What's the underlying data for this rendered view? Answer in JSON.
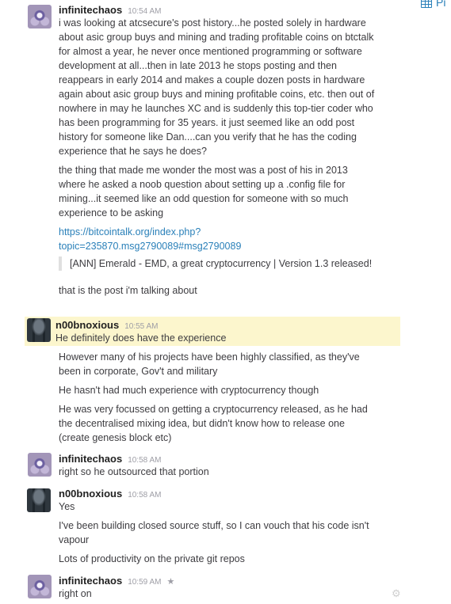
{
  "topright": {
    "label": "Pi"
  },
  "messages": [
    {
      "user": "infinitechaos",
      "time": "10:54 AM",
      "paragraphs": [
        "i was looking at atcsecure's post history...he posted solely in hardware about asic group buys and mining and trading profitable coins on btctalk for almost a year, he never once mentioned programming or software development at all...then in late 2013 he stops posting and then reappears in early 2014 and makes a couple dozen posts in hardware again about asic group buys and mining profitable coins, etc. then out of nowhere in may he launches XC and is suddenly this top-tier coder who has been programming for 35 years. it just seemed like an odd post history for someone like Dan....can you verify that he has the coding experience that he says he does?",
        "the thing that made me wonder the most was a post of his in 2013 where he asked a noob question about setting up a .config file for mining...it seemed like an odd question for someone with so much experience to be asking"
      ],
      "link": "https://bitcointalk.org/index.php?topic=235870.msg2790089#msg2790089",
      "link_line1": "https://bitcointalk.org/index.php?",
      "link_line2": "topic=235870.msg2790089#msg2790089",
      "quote": "[ANN] Emerald - EMD, a great cryptocurrency | Version 1.3 released!",
      "after": "that is the post i'm talking about"
    },
    {
      "user": "n00bnoxious",
      "time": "10:55 AM",
      "first": "He definitely does have the experience",
      "paragraphs": [
        "However many of his projects have been highly classified, as they've been in corporate, Gov't and military",
        "He hasn't had much experience with cryptocurrency though",
        "He was very focussed on getting a cryptocurrency released, as he had the decentralised mixing idea, but didn't know how to release one (create genesis block etc)"
      ]
    },
    {
      "user": "infinitechaos",
      "time": "10:58 AM",
      "paragraphs": [
        "right so he outsourced that portion"
      ]
    },
    {
      "user": "n00bnoxious",
      "time": "10:58 AM",
      "paragraphs": [
        "Yes",
        "I've been building closed source stuff, so I can vouch that his code isn't vapour",
        "Lots of productivity on the private git repos"
      ]
    },
    {
      "user": "infinitechaos",
      "time": "10:59 AM",
      "star_icon": "star-icon",
      "paragraphs": [
        "right on"
      ]
    }
  ],
  "icons": {
    "settings": "gear-icon",
    "calendar": "calendar-icon"
  }
}
